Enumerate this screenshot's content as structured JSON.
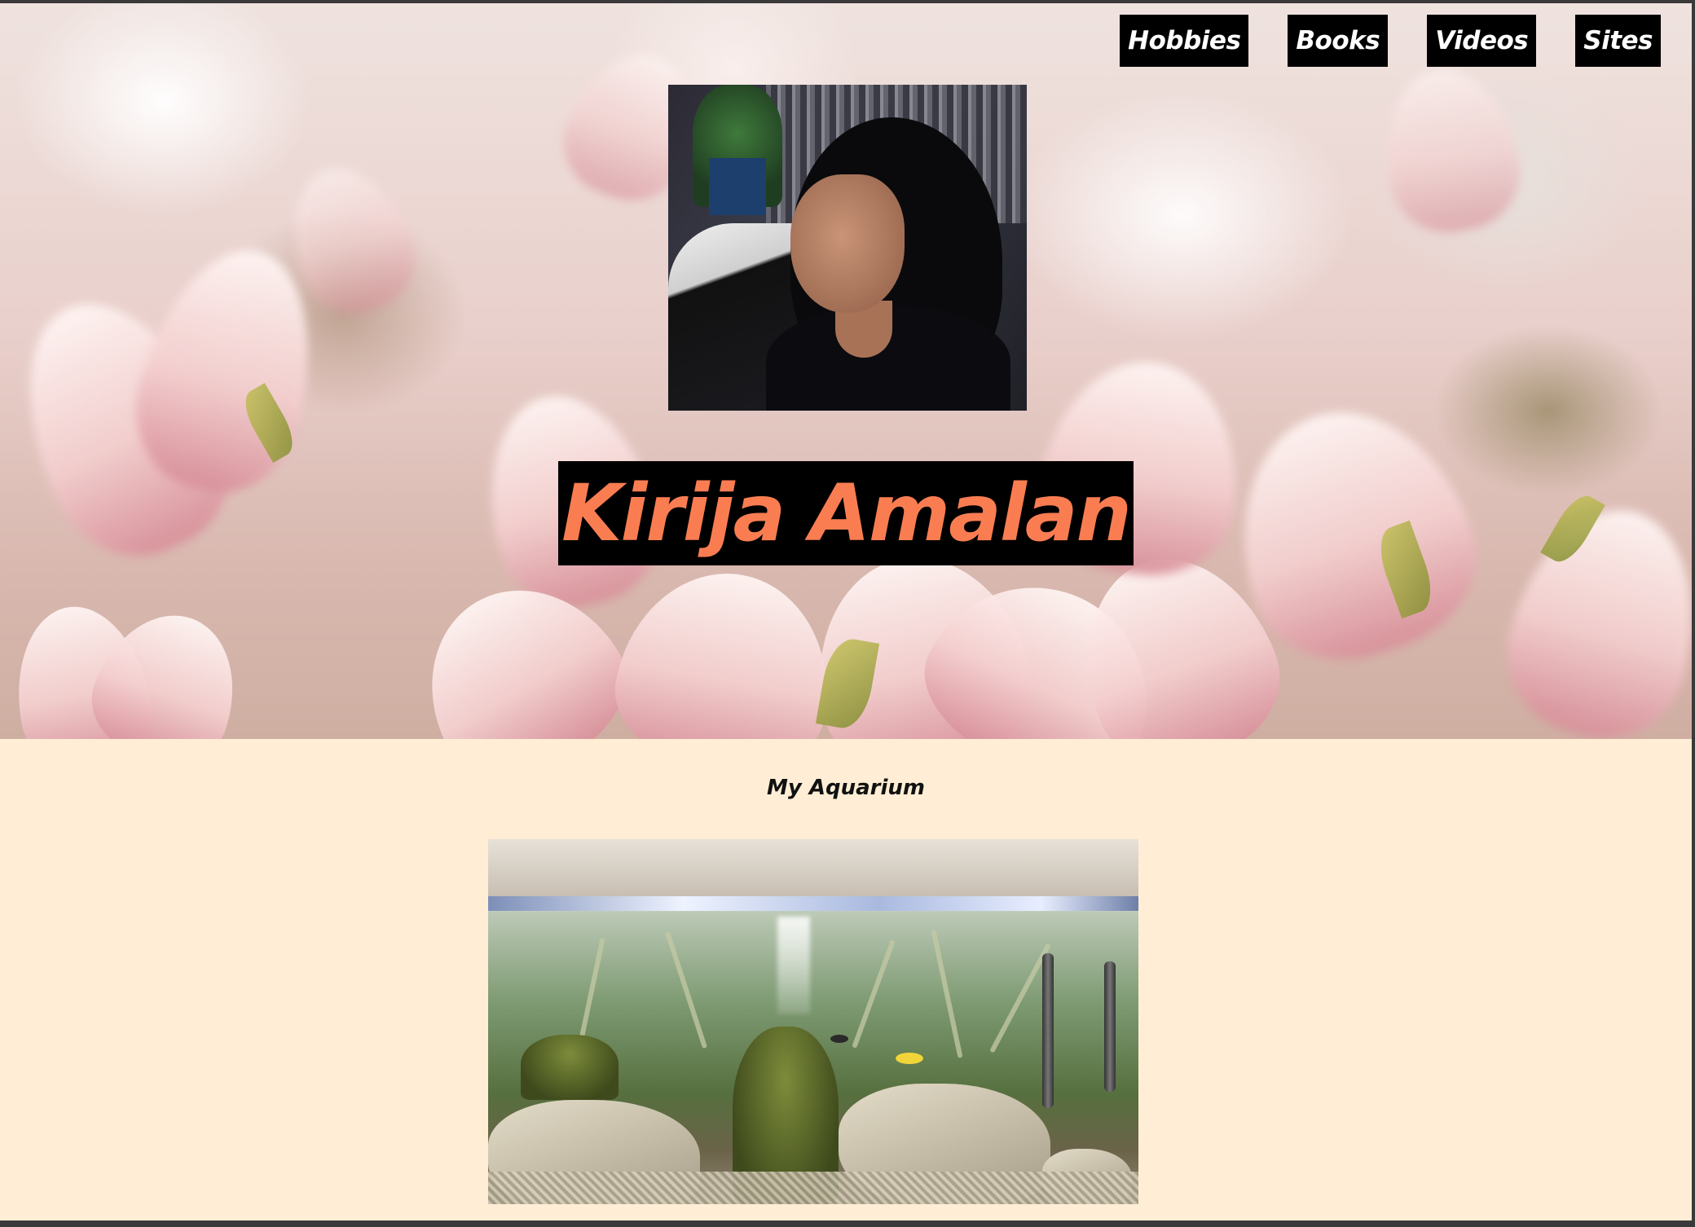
{
  "nav": {
    "items": [
      {
        "label": "Hobbies"
      },
      {
        "label": "Books"
      },
      {
        "label": "Videos"
      },
      {
        "label": "Sites"
      }
    ]
  },
  "hero": {
    "name": "Kirija Amalan",
    "name_color": "#fa7d52",
    "background": "pink magnolia blossoms"
  },
  "content": {
    "section_title": "My Aquarium",
    "background_color": "#ffeed5"
  }
}
